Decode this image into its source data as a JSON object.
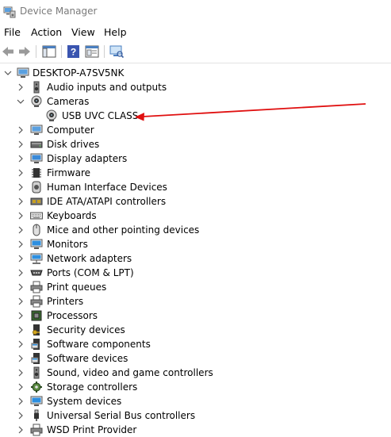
{
  "window": {
    "title": "Device Manager"
  },
  "menu": [
    "File",
    "Action",
    "View",
    "Help"
  ],
  "toolbar": {
    "buttons": [
      "back-icon",
      "forward-icon",
      "show-hide-console-tree-icon",
      "help-icon",
      "properties-icon",
      "scan-hardware-icon"
    ]
  },
  "tree": {
    "root": "DESKTOP-A7SV5NK",
    "items": [
      {
        "label": "Audio inputs and outputs",
        "icon": "speaker-icon",
        "expanded": false
      },
      {
        "label": "Cameras",
        "icon": "camera-icon",
        "expanded": true,
        "children": [
          {
            "label": "USB UVC CLASS",
            "icon": "camera-icon"
          }
        ]
      },
      {
        "label": "Computer",
        "icon": "computer-icon",
        "expanded": false
      },
      {
        "label": "Disk drives",
        "icon": "disk-drive-icon",
        "expanded": false
      },
      {
        "label": "Display adapters",
        "icon": "display-adapter-icon",
        "expanded": false
      },
      {
        "label": "Firmware",
        "icon": "firmware-icon",
        "expanded": false
      },
      {
        "label": "Human Interface Devices",
        "icon": "hid-icon",
        "expanded": false
      },
      {
        "label": "IDE ATA/ATAPI controllers",
        "icon": "ide-controller-icon",
        "expanded": false
      },
      {
        "label": "Keyboards",
        "icon": "keyboard-icon",
        "expanded": false
      },
      {
        "label": "Mice and other pointing devices",
        "icon": "mouse-icon",
        "expanded": false
      },
      {
        "label": "Monitors",
        "icon": "monitor-icon",
        "expanded": false
      },
      {
        "label": "Network adapters",
        "icon": "network-adapter-icon",
        "expanded": false
      },
      {
        "label": "Ports (COM & LPT)",
        "icon": "port-icon",
        "expanded": false
      },
      {
        "label": "Print queues",
        "icon": "printer-icon",
        "expanded": false
      },
      {
        "label": "Printers",
        "icon": "printer-icon",
        "expanded": false
      },
      {
        "label": "Processors",
        "icon": "processor-icon",
        "expanded": false
      },
      {
        "label": "Security devices",
        "icon": "security-device-icon",
        "expanded": false
      },
      {
        "label": "Software components",
        "icon": "software-component-icon",
        "expanded": false
      },
      {
        "label": "Software devices",
        "icon": "software-device-icon",
        "expanded": false
      },
      {
        "label": "Sound, video and game controllers",
        "icon": "speaker-icon",
        "expanded": false
      },
      {
        "label": "Storage controllers",
        "icon": "storage-controller-icon",
        "expanded": false
      },
      {
        "label": "System devices",
        "icon": "system-device-icon",
        "expanded": false
      },
      {
        "label": "Universal Serial Bus controllers",
        "icon": "usb-icon",
        "expanded": false
      },
      {
        "label": "WSD Print Provider",
        "icon": "printer-icon",
        "expanded": false
      }
    ]
  },
  "annotation": {
    "color": "#e01010",
    "points_to": "USB UVC CLASS"
  }
}
